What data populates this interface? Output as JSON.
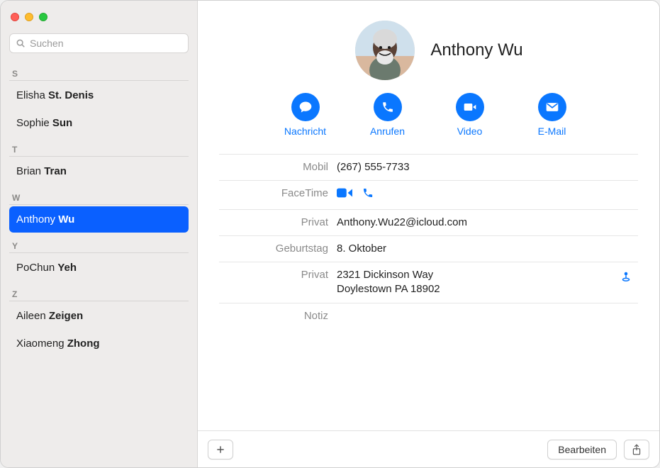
{
  "search": {
    "placeholder": "Suchen"
  },
  "sidebar": {
    "sections": [
      {
        "letter": "S",
        "contacts": [
          {
            "first": "Elisha",
            "last": "St. Denis",
            "selected": false
          },
          {
            "first": "Sophie",
            "last": "Sun",
            "selected": false
          }
        ]
      },
      {
        "letter": "T",
        "contacts": [
          {
            "first": "Brian",
            "last": "Tran",
            "selected": false
          }
        ]
      },
      {
        "letter": "W",
        "contacts": [
          {
            "first": "Anthony",
            "last": "Wu",
            "selected": true
          }
        ]
      },
      {
        "letter": "Y",
        "contacts": [
          {
            "first": "PoChun",
            "last": "Yeh",
            "selected": false
          }
        ]
      },
      {
        "letter": "Z",
        "contacts": [
          {
            "first": "Aileen",
            "last": "Zeigen",
            "selected": false
          },
          {
            "first": "Xiaomeng",
            "last": "Zhong",
            "selected": false
          }
        ]
      }
    ]
  },
  "contact": {
    "name": "Anthony Wu",
    "actions": {
      "message": "Nachricht",
      "call": "Anrufen",
      "video": "Video",
      "email": "E-Mail"
    },
    "fields": {
      "mobile_label": "Mobil",
      "mobile_value": "(267) 555-7733",
      "facetime_label": "FaceTime",
      "private_email_label": "Privat",
      "private_email_value": "Anthony.Wu22@icloud.com",
      "birthday_label": "Geburtstag",
      "birthday_value": "8. Oktober",
      "private_address_label": "Privat",
      "private_address_value": "2321 Dickinson Way\nDoylestown PA 18902",
      "note_label": "Notiz"
    }
  },
  "buttons": {
    "edit": "Bearbeiten"
  }
}
